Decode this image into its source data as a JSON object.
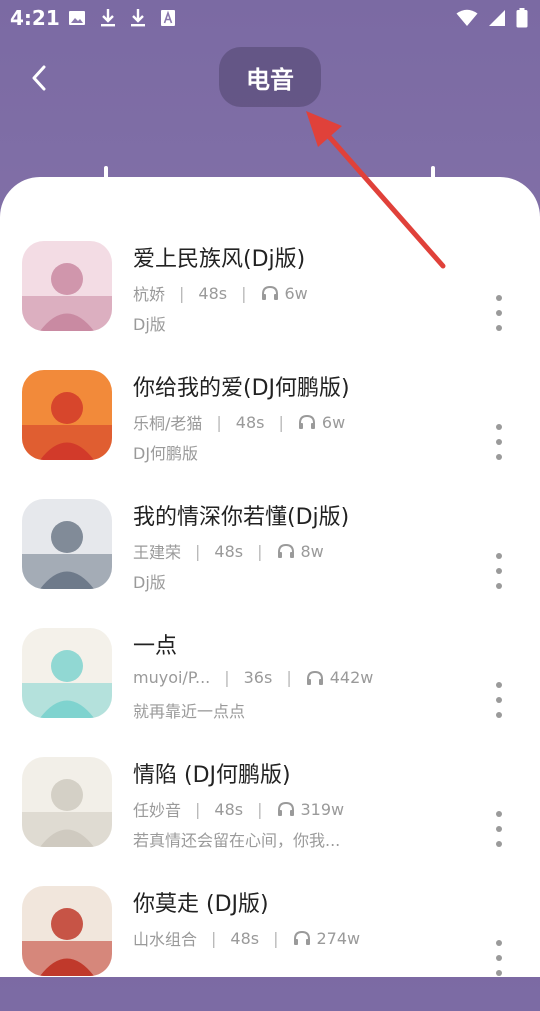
{
  "status_bar": {
    "time": "4:21",
    "left_icons": [
      "image-icon",
      "download-icon",
      "download-icon",
      "font-a-icon"
    ],
    "right_icons": [
      "wifi-icon",
      "signal-icon",
      "battery-icon"
    ]
  },
  "header": {
    "title": "电音",
    "back_icon": "chevron-left-icon"
  },
  "songs": [
    {
      "title": "爱上民族风(Dj版)",
      "artist": "杭娇",
      "duration": "48s",
      "plays": "6w",
      "subtitle": "Dj版",
      "cover_colors": [
        "#c98aa2",
        "#f3dce4"
      ]
    },
    {
      "title": "你给我的爱(DJ何鹏版)",
      "artist": "乐桐/老猫",
      "duration": "48s",
      "plays": "6w",
      "subtitle": "DJ何鹏版",
      "cover_colors": [
        "#d23a2a",
        "#f28a3a"
      ]
    },
    {
      "title": "我的情深你若懂(Dj版)",
      "artist": "王建荣",
      "duration": "48s",
      "plays": "8w",
      "subtitle": "Dj版",
      "cover_colors": [
        "#6e7a8a",
        "#e6e8ec"
      ]
    },
    {
      "title": "一点",
      "artist": "muyoi/P...",
      "duration": "36s",
      "plays": "442w",
      "subtitle": "就再靠近一点点",
      "cover_colors": [
        "#7fd3cf",
        "#f4f1ea"
      ]
    },
    {
      "title": "情陷 (DJ何鹏版)",
      "artist": "任妙音",
      "duration": "48s",
      "plays": "319w",
      "subtitle": "若真情还会留在心间，你我...",
      "cover_colors": [
        "#cfcac0",
        "#f2efe8"
      ]
    },
    {
      "title": "你莫走 (DJ版)",
      "artist": "山水组合",
      "duration": "48s",
      "plays": "274w",
      "subtitle": "",
      "cover_colors": [
        "#c0392b",
        "#f1e6dc"
      ]
    }
  ],
  "colors": {
    "header_bg": "#7b6aa3",
    "annotation_arrow": "#e0413a",
    "meta_text": "#9a9a9a"
  }
}
